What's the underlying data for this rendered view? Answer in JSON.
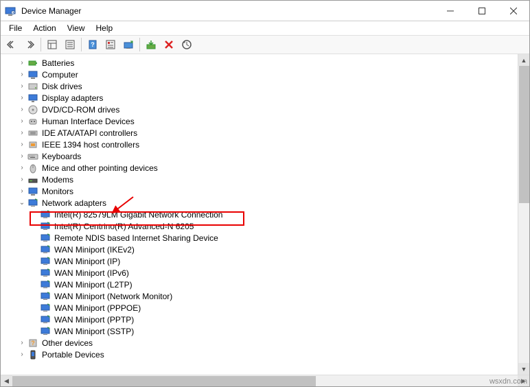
{
  "window": {
    "title": "Device Manager"
  },
  "menu": {
    "file": "File",
    "action": "Action",
    "view": "View",
    "help": "Help"
  },
  "tree": {
    "items": [
      {
        "label": "Batteries",
        "expanded": false,
        "level": 1,
        "icon": "battery"
      },
      {
        "label": "Computer",
        "expanded": false,
        "level": 1,
        "icon": "computer"
      },
      {
        "label": "Disk drives",
        "expanded": false,
        "level": 1,
        "icon": "disk"
      },
      {
        "label": "Display adapters",
        "expanded": false,
        "level": 1,
        "icon": "display"
      },
      {
        "label": "DVD/CD-ROM drives",
        "expanded": false,
        "level": 1,
        "icon": "dvd"
      },
      {
        "label": "Human Interface Devices",
        "expanded": false,
        "level": 1,
        "icon": "hid"
      },
      {
        "label": "IDE ATA/ATAPI controllers",
        "expanded": false,
        "level": 1,
        "icon": "ide"
      },
      {
        "label": "IEEE 1394 host controllers",
        "expanded": false,
        "level": 1,
        "icon": "ieee"
      },
      {
        "label": "Keyboards",
        "expanded": false,
        "level": 1,
        "icon": "keyboard"
      },
      {
        "label": "Mice and other pointing devices",
        "expanded": false,
        "level": 1,
        "icon": "mouse"
      },
      {
        "label": "Modems",
        "expanded": false,
        "level": 1,
        "icon": "modem"
      },
      {
        "label": "Monitors",
        "expanded": false,
        "level": 1,
        "icon": "monitor"
      },
      {
        "label": "Network adapters",
        "expanded": true,
        "level": 1,
        "icon": "network"
      },
      {
        "label": "Intel(R) 82579LM Gigabit Network Connection",
        "expanded": null,
        "level": 2,
        "icon": "netcard",
        "highlighted": true
      },
      {
        "label": "Intel(R) Centrino(R) Advanced-N 6205",
        "expanded": null,
        "level": 2,
        "icon": "netcard"
      },
      {
        "label": "Remote NDIS based Internet Sharing Device",
        "expanded": null,
        "level": 2,
        "icon": "netcard"
      },
      {
        "label": "WAN Miniport (IKEv2)",
        "expanded": null,
        "level": 2,
        "icon": "netcard"
      },
      {
        "label": "WAN Miniport (IP)",
        "expanded": null,
        "level": 2,
        "icon": "netcard"
      },
      {
        "label": "WAN Miniport (IPv6)",
        "expanded": null,
        "level": 2,
        "icon": "netcard"
      },
      {
        "label": "WAN Miniport (L2TP)",
        "expanded": null,
        "level": 2,
        "icon": "netcard"
      },
      {
        "label": "WAN Miniport (Network Monitor)",
        "expanded": null,
        "level": 2,
        "icon": "netcard"
      },
      {
        "label": "WAN Miniport (PPPOE)",
        "expanded": null,
        "level": 2,
        "icon": "netcard"
      },
      {
        "label": "WAN Miniport (PPTP)",
        "expanded": null,
        "level": 2,
        "icon": "netcard"
      },
      {
        "label": "WAN Miniport (SSTP)",
        "expanded": null,
        "level": 2,
        "icon": "netcard"
      },
      {
        "label": "Other devices",
        "expanded": false,
        "level": 1,
        "icon": "other"
      },
      {
        "label": "Portable Devices",
        "expanded": false,
        "level": 1,
        "icon": "portable"
      }
    ]
  },
  "watermark": "wsxdn.com"
}
